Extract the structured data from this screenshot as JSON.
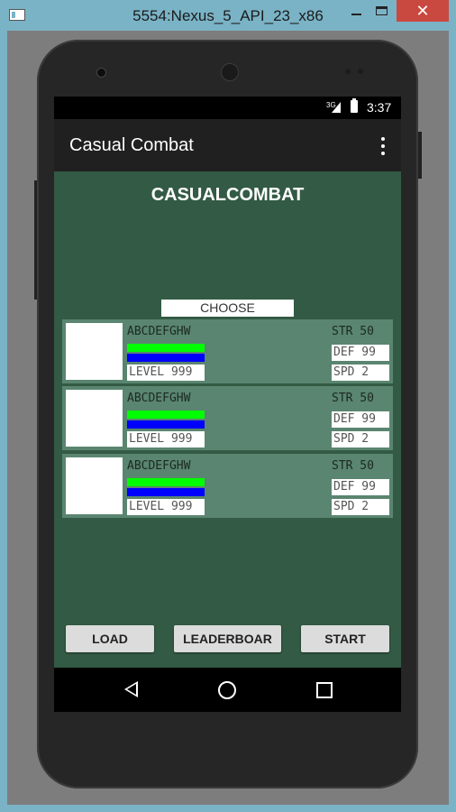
{
  "window": {
    "title": "5554:Nexus_5_API_23_x86",
    "close_glyph": "✕"
  },
  "status_bar": {
    "network": "3G",
    "time": "3:37"
  },
  "app_bar": {
    "title": "Casual Combat"
  },
  "main": {
    "title": "CASUALCOMBAT",
    "choose_label": "CHOOSE CHARACTER"
  },
  "characters": [
    {
      "name": "ABCDEFGHW",
      "level": "LEVEL 999",
      "str": "STR 50",
      "def": "DEF 99",
      "spd": "SPD 2"
    },
    {
      "name": "ABCDEFGHW",
      "level": "LEVEL 999",
      "str": "STR 50",
      "def": "DEF 99",
      "spd": "SPD 2"
    },
    {
      "name": "ABCDEFGHW",
      "level": "LEVEL 999",
      "str": "STR 50",
      "def": "DEF 99",
      "spd": "SPD 2"
    }
  ],
  "buttons": {
    "load": "LOAD",
    "leaderboard": "LEADERBOAR",
    "start": "START"
  },
  "colors": {
    "screen_bg": "#335a44",
    "card_bg": "#5a8570",
    "hp_bar": "#00ff00",
    "mp_bar": "#0000ff",
    "app_bar": "#202020"
  }
}
